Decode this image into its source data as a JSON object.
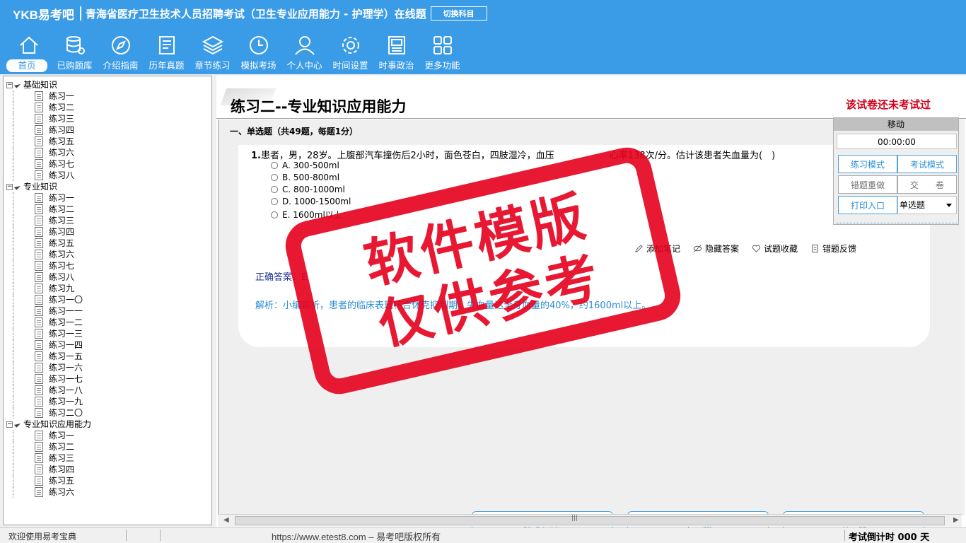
{
  "header": {
    "brand_ykb": "YKB",
    "brand_cn": "易考吧",
    "exam_title": "青海省医疗卫生技术人员招聘考试（卫生专业应用能力 - 护理学）在线题",
    "switch_label": "切换科目"
  },
  "nav": [
    {
      "label": "首页",
      "icon": "home-icon"
    },
    {
      "label": "已购题库",
      "icon": "database-icon"
    },
    {
      "label": "介绍指南",
      "icon": "compass-icon"
    },
    {
      "label": "历年真题",
      "icon": "list-icon"
    },
    {
      "label": "章节练习",
      "icon": "layers-icon"
    },
    {
      "label": "模拟考场",
      "icon": "clock-icon"
    },
    {
      "label": "个人中心",
      "icon": "user-icon"
    },
    {
      "label": "时间设置",
      "icon": "gear-icon"
    },
    {
      "label": "时事政治",
      "icon": "news-icon"
    },
    {
      "label": "更多功能",
      "icon": "grid-icon"
    }
  ],
  "tree": [
    {
      "group": "基础知识",
      "items": [
        "练习一",
        "练习二",
        "练习三",
        "练习四",
        "练习五",
        "练习六",
        "练习七",
        "练习八"
      ]
    },
    {
      "group": "专业知识",
      "items": [
        "练习一",
        "练习二",
        "练习三",
        "练习四",
        "练习五",
        "练习六",
        "练习七",
        "练习八",
        "练习九",
        "练习一〇",
        "练习一一",
        "练习一二",
        "练习一三",
        "练习一四",
        "练习一五",
        "练习一六",
        "练习一七",
        "练习一八",
        "练习一九",
        "练习二〇"
      ]
    },
    {
      "group": "专业知识应用能力",
      "items": [
        "练习一",
        "练习二",
        "练习三",
        "练习四",
        "练习五",
        "练习六"
      ]
    }
  ],
  "main": {
    "paper_title": "练习二--专业知识应用能力",
    "not_taken": "该试卷还未考试过",
    "section_header": "一、单选题（共49题，每题1分）",
    "question_no": "1.",
    "question_text": "患者，男，28岁。上腹部汽车撞伤后2小时，面色苍白，四肢湿冷，血压　　　　　　心率138次/分。估计该患者失血量为(　)",
    "options": [
      "A. 300-500ml",
      "B. 500-800ml",
      "C. 800-1000ml",
      "D. 1000-1500ml",
      "E. 1600ml以上"
    ],
    "tools": [
      "添加笔记",
      "隐藏答案",
      "试题收藏",
      "错题反馈"
    ],
    "answer_label": "正确答案：E",
    "analysis": "解析：小编解析，患者的临床表现符合休克抑制期，失血量达全身血量的40%，约1600ml以上。",
    "buttons": {
      "submit": "提交答案",
      "prev": "上一题",
      "next": "下一题"
    }
  },
  "control": {
    "move": "移动",
    "timer": "00:00:00",
    "practice_mode": "练习模式",
    "exam_mode": "考试模式",
    "redo_wrong": "错题重做",
    "hand_in": "交　　卷",
    "print": "打印入口",
    "type_select": "单选题"
  },
  "stamp": {
    "line1": "软件模版",
    "line2": "仅供参考"
  },
  "status": {
    "welcome": "欢迎使用易考宝典",
    "url": "https://www.etest8.com – 易考吧版权所有",
    "countdown": "考试倒计时 000 天"
  }
}
